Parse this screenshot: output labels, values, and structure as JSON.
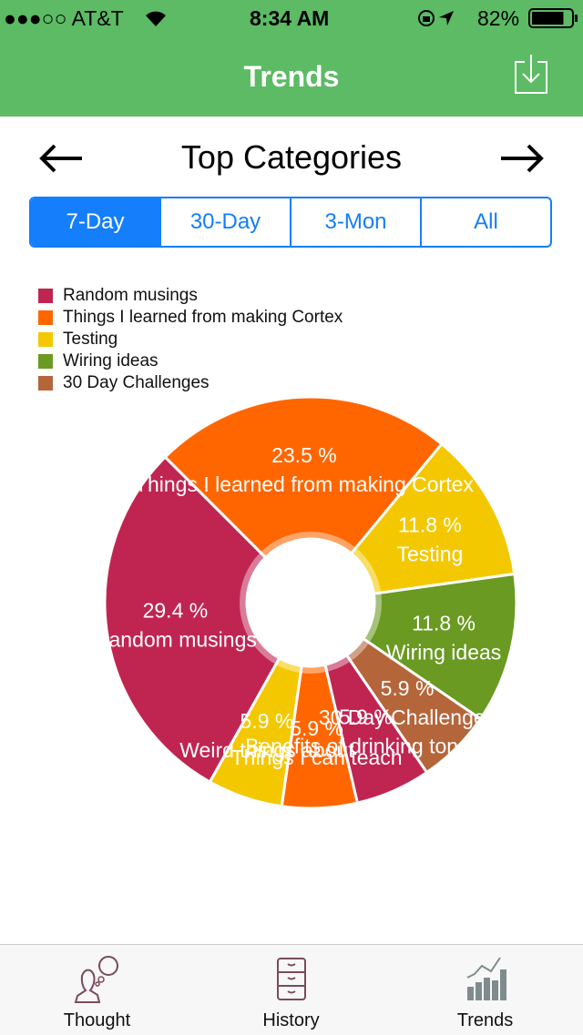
{
  "status_bar": {
    "carrier": "●●●○○ AT&T",
    "time": "8:34 AM",
    "battery": "82%",
    "battery_level": 0.82
  },
  "header": {
    "title": "Trends",
    "download_icon": "download-icon"
  },
  "page": {
    "title": "Top Categories",
    "prev_icon": "arrow-left-icon",
    "next_icon": "arrow-right-icon"
  },
  "range_tabs": [
    {
      "label": "7-Day",
      "selected": true
    },
    {
      "label": "30-Day",
      "selected": false
    },
    {
      "label": "3-Mon",
      "selected": false
    },
    {
      "label": "All",
      "selected": false
    }
  ],
  "legend": [
    {
      "label": "Random musings",
      "color": "#c02552"
    },
    {
      "label": "Things I learned from making Cortex",
      "color": "#ff6600"
    },
    {
      "label": "Testing",
      "color": "#f4c800"
    },
    {
      "label": "Wiring ideas",
      "color": "#6a9a22"
    },
    {
      "label": "30 Day Challenges",
      "color": "#b5653a"
    }
  ],
  "chart_data": {
    "type": "pie",
    "donut": true,
    "slices": [
      {
        "label": "Random musings",
        "percent": 29.4,
        "display": "29.4 %",
        "color": "#c02552"
      },
      {
        "label": "Things I learned from making Cortex",
        "percent": 23.5,
        "display": "23.5 %",
        "color": "#ff6600"
      },
      {
        "label": "Testing",
        "percent": 11.8,
        "display": "11.8 %",
        "color": "#f4c800"
      },
      {
        "label": "Wiring ideas",
        "percent": 11.8,
        "display": "11.8 %",
        "color": "#6a9a22"
      },
      {
        "label": "30 Day Challenges",
        "percent": 5.9,
        "display": "5.9 %",
        "color": "#b5653a"
      },
      {
        "label": "Benefits of drinking tons o",
        "percent": 5.9,
        "display": "5.9 %",
        "color": "#c02552"
      },
      {
        "label": "Things I can teach",
        "percent": 5.9,
        "display": "5.9 %",
        "color": "#ff6600"
      },
      {
        "label": "Weird things about",
        "percent": 5.9,
        "display": "5.9 %",
        "color": "#f4c800"
      }
    ]
  },
  "tab_bar": [
    {
      "label": "Thought",
      "icon": "thought-bubble-icon"
    },
    {
      "label": "History",
      "icon": "file-cabinet-icon"
    },
    {
      "label": "Trends",
      "icon": "trend-chart-icon"
    }
  ]
}
